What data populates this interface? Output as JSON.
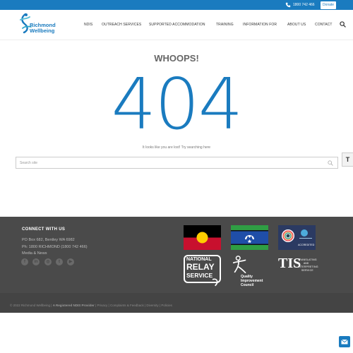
{
  "topbar": {
    "phone": "1800 742 466",
    "donate_label": "Donate"
  },
  "header": {
    "logo_line1": "Richmond",
    "logo_line2": "Wellbeing",
    "nav": [
      {
        "label": "NDIS"
      },
      {
        "label": "OUTREACH SERVICES"
      },
      {
        "label": "SUPPORTED ACCOMMODATION"
      },
      {
        "label": "TRAINING"
      },
      {
        "label": "INFORMATION FOR"
      },
      {
        "label": "ABOUT US"
      },
      {
        "label": "CONTACT"
      }
    ]
  },
  "main": {
    "heading": "WHOOPS!",
    "code": "404",
    "message": "It looks like you are lost! Try searching here",
    "search_placeholder": "Search site"
  },
  "accessibility": {
    "label": "T"
  },
  "footer": {
    "connect_title": "CONNECT WITH US",
    "address": "PO Box 682, Bentley WA 6982",
    "phone": "Ph: 1800 RICHMOND (1800 742 466)",
    "media": "Media & News",
    "socials": [
      "facebook-icon",
      "linkedin-icon",
      "instagram-icon",
      "twitter-icon",
      "youtube-icon"
    ],
    "badges": {
      "accredited": "ACCREDITED",
      "relay_line1": "NATIONAL",
      "relay_line2": "RELAY",
      "relay_line3": "SERVICE",
      "qic_line1": "Quality",
      "qic_line2": "Improvement",
      "qic_line3": "Council",
      "tis_logo": "TIS",
      "tis_line1": "TRANSLATING",
      "tis_line2": "AND",
      "tis_line3": "INTERPRETING",
      "tis_line4": "SERVICE"
    }
  },
  "copyright": {
    "org": "© 2022 Richmond Wellbeing",
    "provider": "A Registered NDIS Provider",
    "links": [
      "Privacy",
      "Complaints & Feedback",
      "Diversity",
      "Policies"
    ]
  },
  "colors": {
    "brand_blue": "#1a7bbf",
    "footer_bg": "#4a4a4a"
  }
}
